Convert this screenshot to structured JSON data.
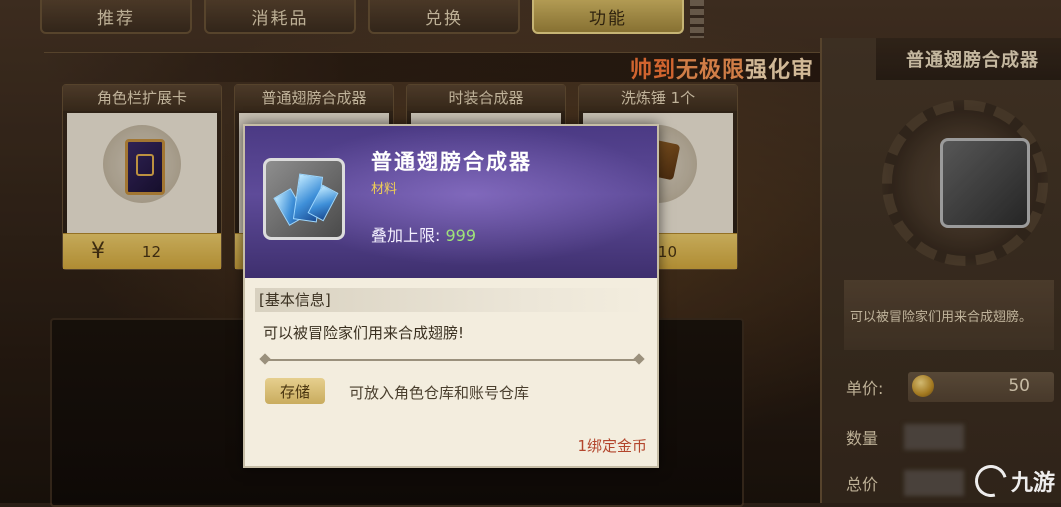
{
  "tabs": [
    "推荐",
    "消耗品",
    "兑换",
    "功能"
  ],
  "active_tab": "功能",
  "banner": {
    "part1": "帅到",
    "part2": "无极限",
    "part3": "强化审"
  },
  "shop_items": [
    {
      "name": "角色栏扩展卡",
      "price": "12",
      "currency": "¥"
    },
    {
      "name": "普通翅膀合成器",
      "price": ""
    },
    {
      "name": "时装合成器",
      "price": ""
    },
    {
      "name": "洗炼锤 1个",
      "price": "10"
    }
  ],
  "detail_panel": {
    "title": "普通翅膀合成器",
    "description": "可以被冒险家们用来合成翅膀。",
    "unit_price_label": "单价:",
    "unit_price_value": "50",
    "quantity_label": "数量",
    "total_label": "总价"
  },
  "tooltip": {
    "name": "普通翅膀合成器",
    "type": "材料",
    "stack_label": "叠加上限:",
    "stack_value": "999",
    "section_title": "[基本信息]",
    "description": "可以被冒险家们用来合成翅膀!",
    "storage_tag": "存储",
    "storage_text": "可放入角色仓库和账号仓库",
    "bind_text": "1绑定金币"
  },
  "watermark": "九游",
  "colors": {
    "accent_gold": "#d6ab3f",
    "tooltip_header": "#4b3a84",
    "stack_value": "#9fe27a",
    "bind_red": "#b3452c"
  }
}
